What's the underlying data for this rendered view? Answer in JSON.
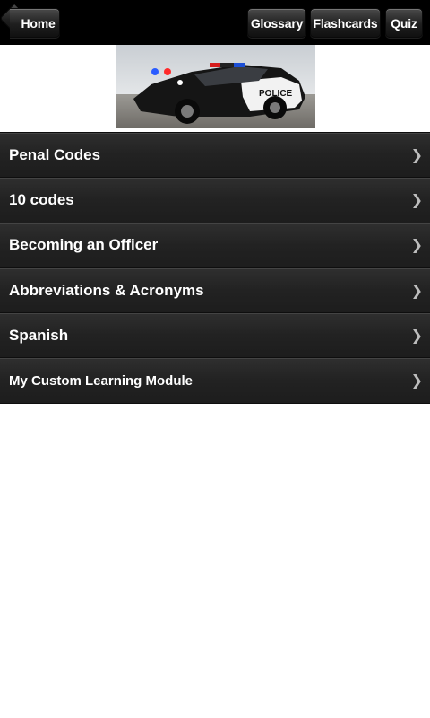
{
  "toolbar": {
    "home_label": "Home",
    "glossary_label": "Glossary",
    "flashcards_label": "Flashcards",
    "quiz_label": "Quiz"
  },
  "hero": {
    "car_text": "POLICE"
  },
  "menu": {
    "items": [
      {
        "label": "Penal Codes"
      },
      {
        "label": "10 codes"
      },
      {
        "label": "Becoming an Officer"
      },
      {
        "label": "Abbreviations & Acronyms"
      },
      {
        "label": "Spanish"
      },
      {
        "label": "My Custom Learning Module"
      }
    ],
    "chevron": "❯"
  }
}
